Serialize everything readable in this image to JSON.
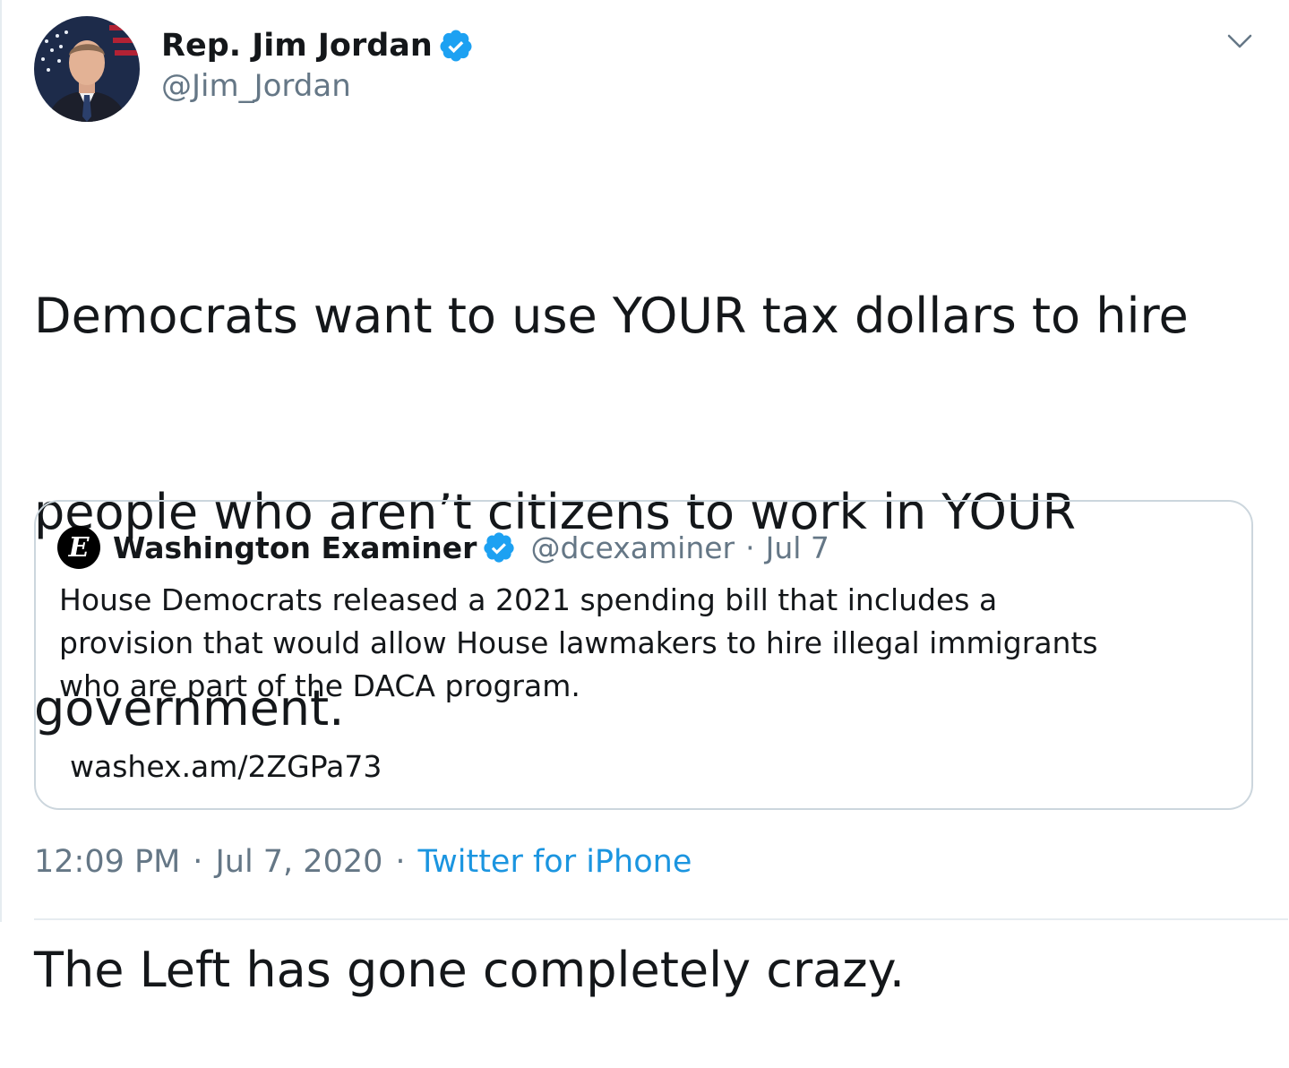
{
  "tweet": {
    "author": {
      "display_name": "Rep. Jim Jordan",
      "handle": "@Jim_Jordan",
      "verified": true,
      "avatar_icon": "portrait-avatar"
    },
    "text_lines": [
      "Democrats want to use YOUR tax dollars to hire",
      "people who aren’t citizens to work in YOUR",
      "government.",
      "The Left has gone completely crazy."
    ],
    "menu_icon": "chevron-down-icon",
    "time": "12:09 PM",
    "date": "Jul 7, 2020",
    "separator": "·",
    "source": "Twitter for iPhone"
  },
  "quoted_tweet": {
    "display_name": "Washington Examiner",
    "handle": "@dcexaminer",
    "separator": "·",
    "date": "Jul 7",
    "avatar_letter": "E",
    "body_lines": [
      "House Democrats released a 2021 spending bill that includes a",
      "provision that would allow House lawmakers to hire illegal immigrants",
      "who are part of the DACA program."
    ],
    "link": "washex.am/2ZGPa73"
  },
  "colors": {
    "verified_blue": "#1da1f2",
    "secondary_text": "#657786",
    "link_blue": "#1b95e0",
    "border": "#ccd6dd"
  }
}
